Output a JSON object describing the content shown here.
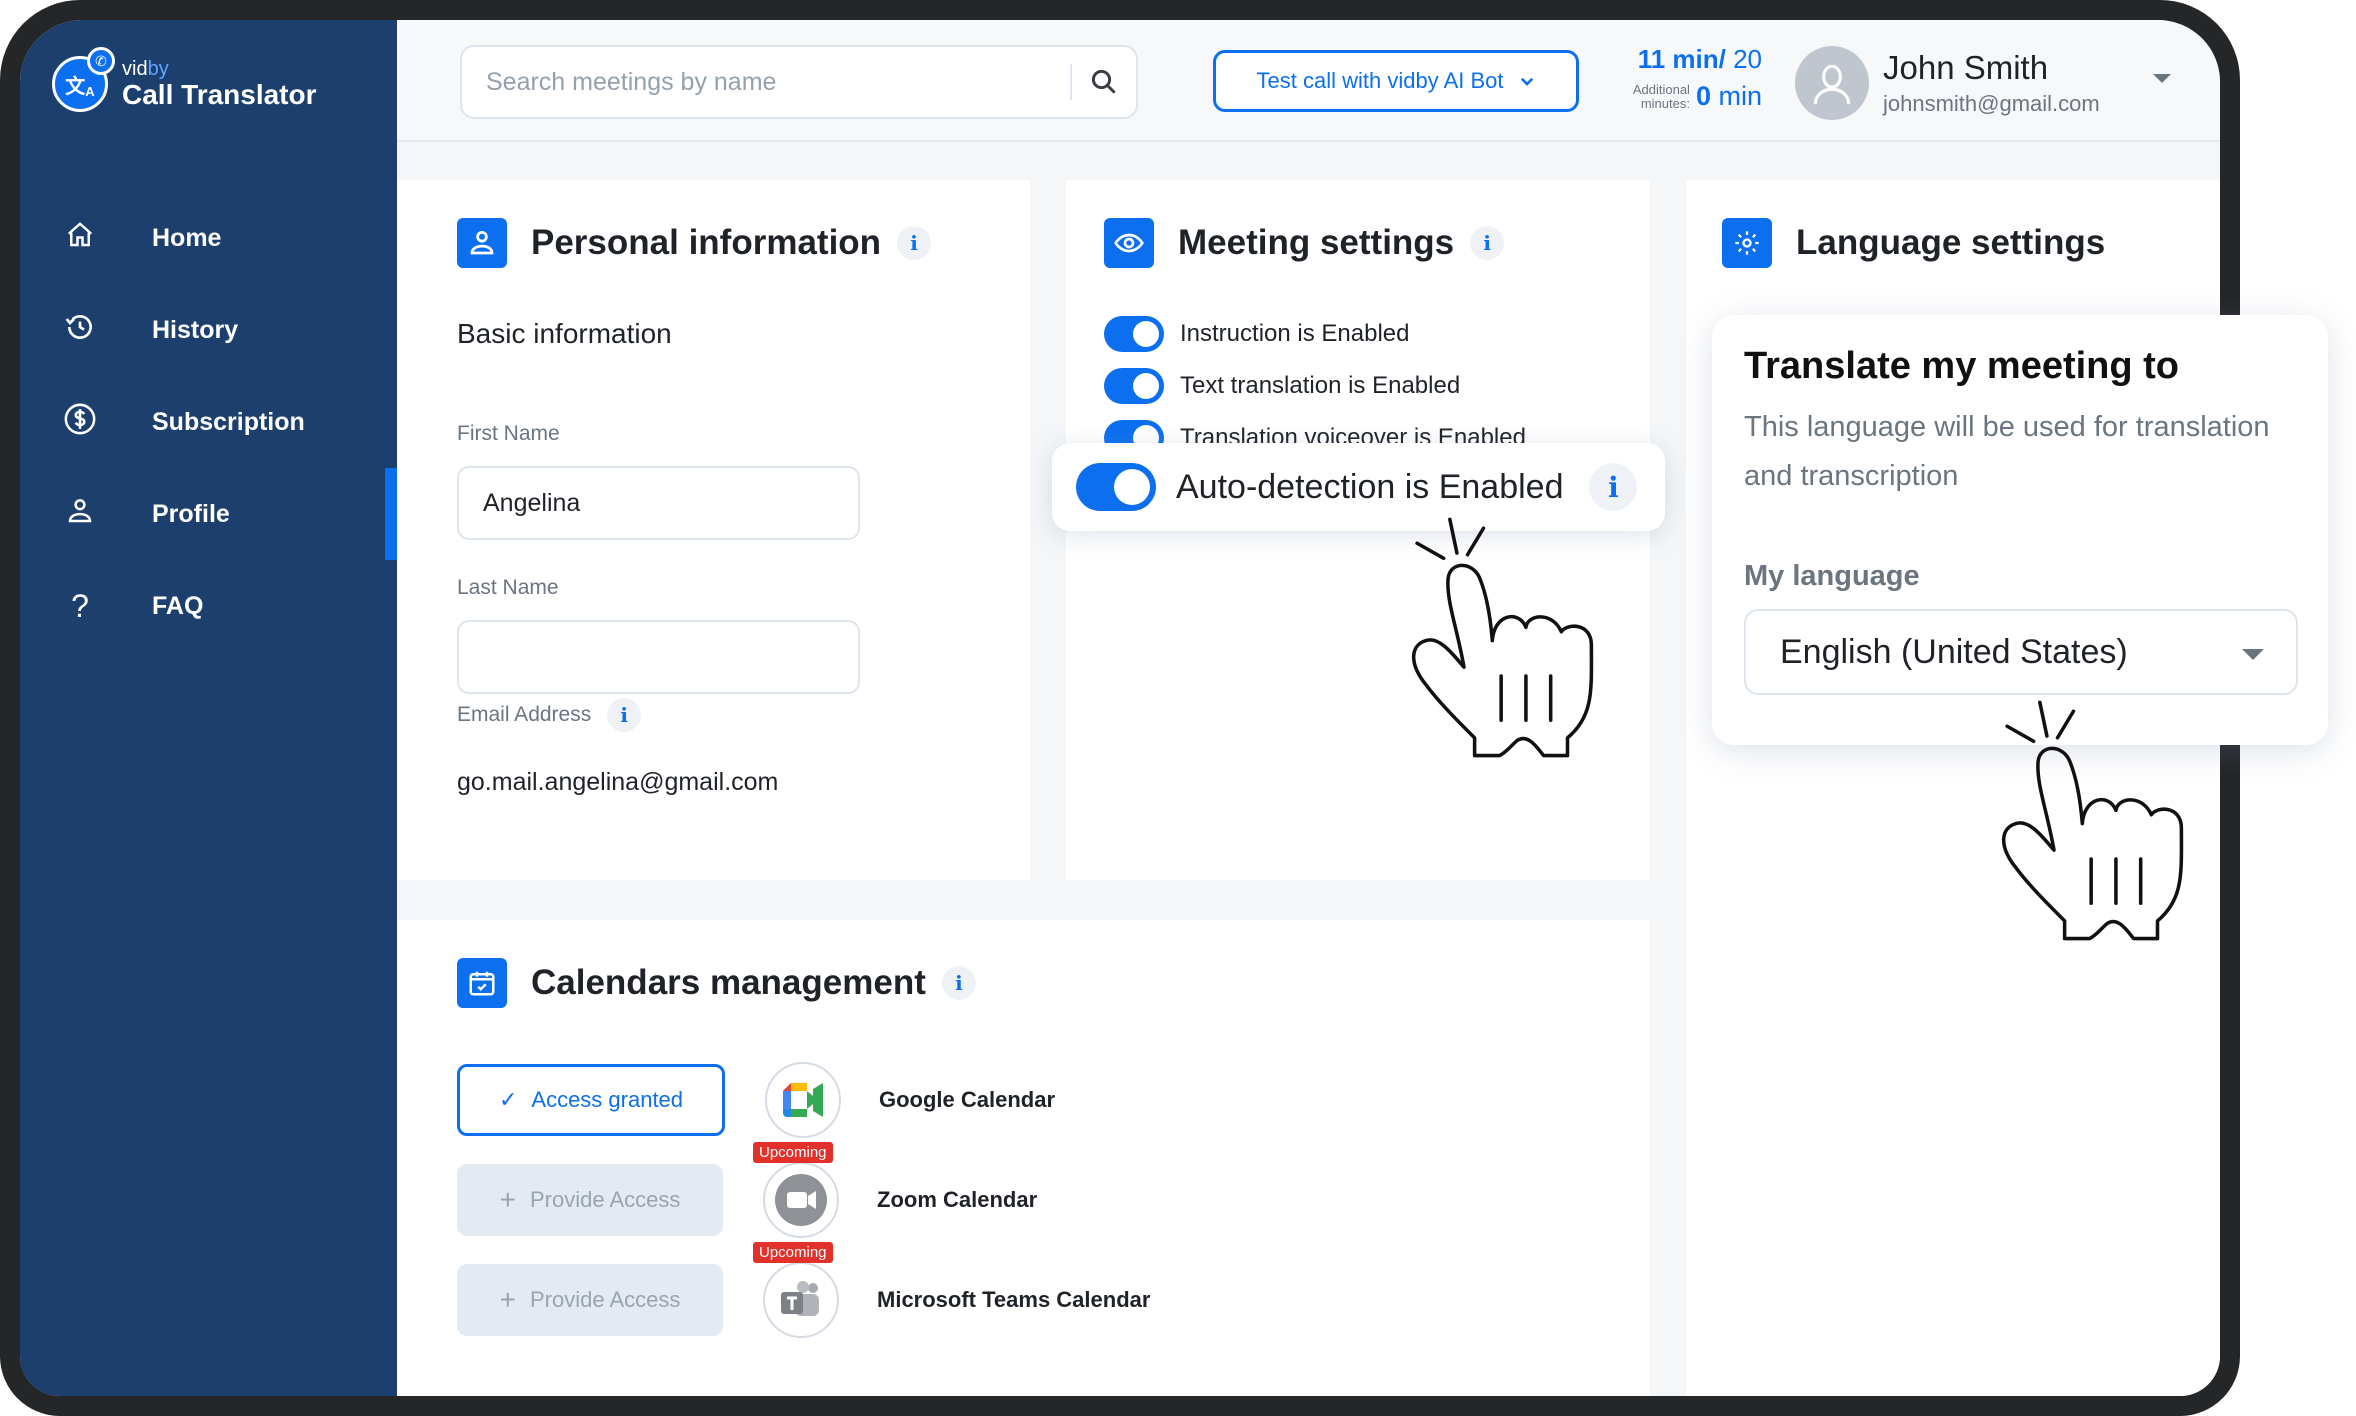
{
  "app": {
    "brand_prefix": "vid",
    "brand_suffix": "by",
    "name": "Call Translator"
  },
  "sidebar": {
    "items": [
      {
        "label": "Home",
        "icon": "home-icon",
        "active": false
      },
      {
        "label": "History",
        "icon": "history-icon",
        "active": false
      },
      {
        "label": "Subscription",
        "icon": "dollar-icon",
        "active": false
      },
      {
        "label": "Profile",
        "icon": "user-icon",
        "active": true
      },
      {
        "label": "FAQ",
        "icon": "question-icon",
        "active": false
      }
    ]
  },
  "header": {
    "search_placeholder": "Search meetings by name",
    "test_call_label": "Test call with vidby AI Bot",
    "minutes_used": "11 min/",
    "minutes_total": " 20",
    "additional_label_1": "Additional",
    "additional_label_2": "minutes:",
    "additional_value": "0",
    "additional_unit": " min",
    "user_name": "John Smith",
    "user_email": "johnsmith@gmail.com"
  },
  "personal": {
    "title": "Personal information",
    "info": "i",
    "subtitle": "Basic information",
    "first_name_label": "First Name",
    "first_name_value": "Angelina",
    "last_name_label": "Last Name",
    "last_name_value": "",
    "email_label": "Email Address",
    "email_value": "go.mail.angelina@gmail.com"
  },
  "meeting": {
    "title": "Meeting settings",
    "info": "i",
    "toggles": [
      {
        "label": "Instruction is Enabled",
        "on": true
      },
      {
        "label": "Text translation is Enabled",
        "on": true
      },
      {
        "label": "Translation voiceover is Enabled",
        "on": true
      }
    ],
    "auto_detection": {
      "label": "Auto-detection is Enabled",
      "on": true,
      "info": "i"
    }
  },
  "language": {
    "title": "Language settings",
    "popup_title": "Translate my meeting to",
    "popup_desc": "This language will be used for translation and transcription",
    "my_language_label": "My language",
    "selected_language": "English (United States)"
  },
  "calendars": {
    "title": "Calendars management",
    "info": "i",
    "rows": [
      {
        "button": "Access granted",
        "status": "granted",
        "name": "Google Calendar",
        "badge": null
      },
      {
        "button": "Provide Access",
        "status": "disabled",
        "name": "Zoom Calendar",
        "badge": "Upcoming"
      },
      {
        "button": "Provide Access",
        "status": "disabled",
        "name": "Microsoft Teams Calendar",
        "badge": "Upcoming"
      }
    ]
  },
  "colors": {
    "accent": "#0c6ff0",
    "sidebar": "#1c3f6e",
    "badge": "#e2302a"
  }
}
